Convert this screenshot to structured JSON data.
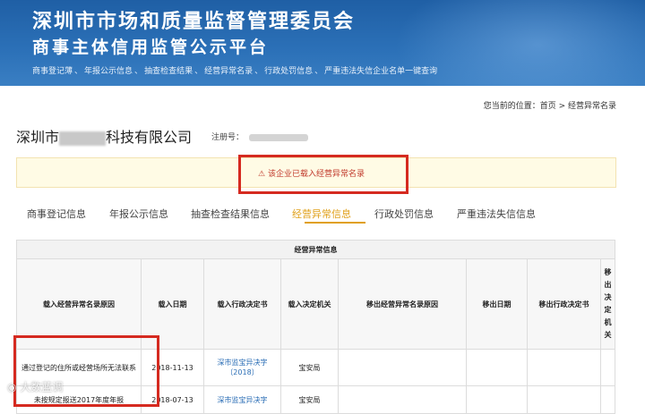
{
  "header": {
    "title": "深圳市市场和质量监督管理委员会",
    "subtitle": "商事主体信用监管公示平台",
    "nav": [
      "商事登记薄",
      "年报公示信息",
      "抽查检查结果",
      "经营异常名录",
      "行政处罚信息",
      "严重违法失信企业名单一键查询"
    ],
    "nav_separator": "、"
  },
  "breadcrumb": "您当前的位置：首页 > 经营异常名录",
  "company": {
    "name_prefix": "深圳市",
    "name_suffix": "科技有限公司",
    "reg_label": "注册号："
  },
  "alert": {
    "text": "该企业已载入经营异常名录"
  },
  "tabs": [
    {
      "label": "商事登记信息",
      "active": false
    },
    {
      "label": "年报公示信息",
      "active": false
    },
    {
      "label": "抽查检查结果信息",
      "active": false
    },
    {
      "label": "经营异常信息",
      "active": true
    },
    {
      "label": "行政处罚信息",
      "active": false
    },
    {
      "label": "严重违法失信信息",
      "active": false
    }
  ],
  "table": {
    "title": "经营异常信息",
    "columns": [
      "载入经营异常名录原因",
      "载入日期",
      "载入行政决定书",
      "载入决定机关",
      "移出经营异常名录原因",
      "移出日期",
      "移出行政决定书",
      "移出决定机关"
    ],
    "rows": [
      {
        "reason": "通过登记的住所或经营场所无法联系",
        "date": "2018-11-13",
        "decision": "深市监宝异决字〔2018〕",
        "authority": "宝安局"
      },
      {
        "reason": "未按规定报送2017年度年报",
        "date": "2018-07-13",
        "decision": "深市监宝异决字",
        "authority": "宝安局"
      }
    ]
  },
  "watermark": "大数蓝调",
  "colors": {
    "banner": "#2c71b8",
    "alert_text": "#c0392b",
    "active_tab": "#e0a01a",
    "highlight_box": "#d52a20",
    "link": "#2a6db5"
  }
}
